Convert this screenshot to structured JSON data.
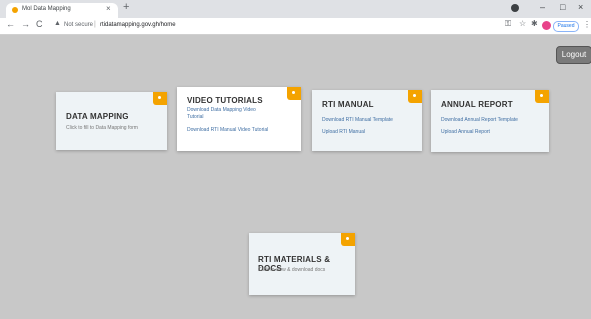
{
  "browser": {
    "tab_title": "Mol Data Mapping",
    "tab_close": "×",
    "new_tab": "+",
    "win_min": "–",
    "win_max": "□",
    "win_close": "×",
    "back": "←",
    "forward": "→",
    "reload": "C",
    "not_secure": "Not secure",
    "separator": "|",
    "url": "rtidatamapping.gov.gh/home",
    "paused": "Paused"
  },
  "header": {
    "logout": "Logout"
  },
  "cards": {
    "data_mapping": {
      "title": "DATA MAPPING",
      "desc": "Click to fill to Data Mapping form"
    },
    "video_tutorials": {
      "title": "VIDEO TUTORIALS",
      "link1_line1": "Download Data Mapping Video",
      "link1_line2": "Tutorial",
      "link2": "Download RTI Manual Video Tutorial"
    },
    "rti_manual": {
      "title": "RTI MANUAL",
      "link1": "Download RTI Manual Template",
      "link2": "Upload RTI Manual"
    },
    "annual_report": {
      "title": "ANNUAL REPORT",
      "link1": "Download Annual Report Template",
      "link2": "Upload Annual Report"
    },
    "rti_materials": {
      "title": "RTI MATERIALS & DOCS",
      "desc": "Click to view & download docs"
    }
  },
  "colors": {
    "accent": "#f4a300",
    "link": "#3f6ea3",
    "background": "#c8c8c8"
  }
}
